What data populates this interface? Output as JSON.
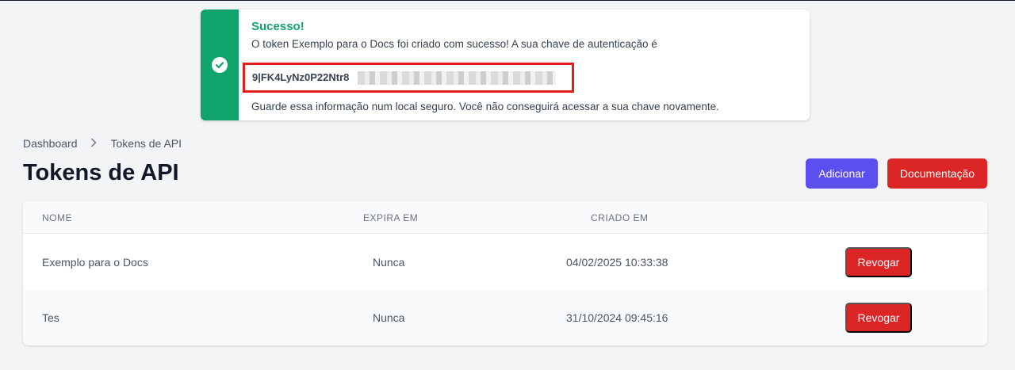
{
  "notification": {
    "title": "Sucesso!",
    "message": "O token Exemplo para o Docs foi criado com sucesso! A sua chave de autenticação é",
    "key_visible": "9|FK4LyNz0P22Ntr8",
    "footer": "Guarde essa informação num local seguro. Você não conseguirá acessar a sua chave novamente.",
    "icon": "check-circle-icon",
    "accent_color": "#10a36b"
  },
  "breadcrumb": {
    "items": [
      "Dashboard",
      "Tokens de API"
    ],
    "separator_icon": "chevron-right-icon"
  },
  "page": {
    "title": "Tokens de API"
  },
  "actions": {
    "add_label": "Adicionar",
    "docs_label": "Documentação",
    "add_color": "#5b4ff0",
    "docs_color": "#dc2626"
  },
  "table": {
    "headers": [
      "NOME",
      "EXPIRA EM",
      "CRIADO EM"
    ],
    "rows": [
      {
        "name": "Exemplo para o Docs",
        "expires": "Nunca",
        "created": "04/02/2025 10:33:38",
        "action": "Revogar"
      },
      {
        "name": "Tes",
        "expires": "Nunca",
        "created": "31/10/2024 09:45:16",
        "action": "Revogar"
      }
    ]
  }
}
